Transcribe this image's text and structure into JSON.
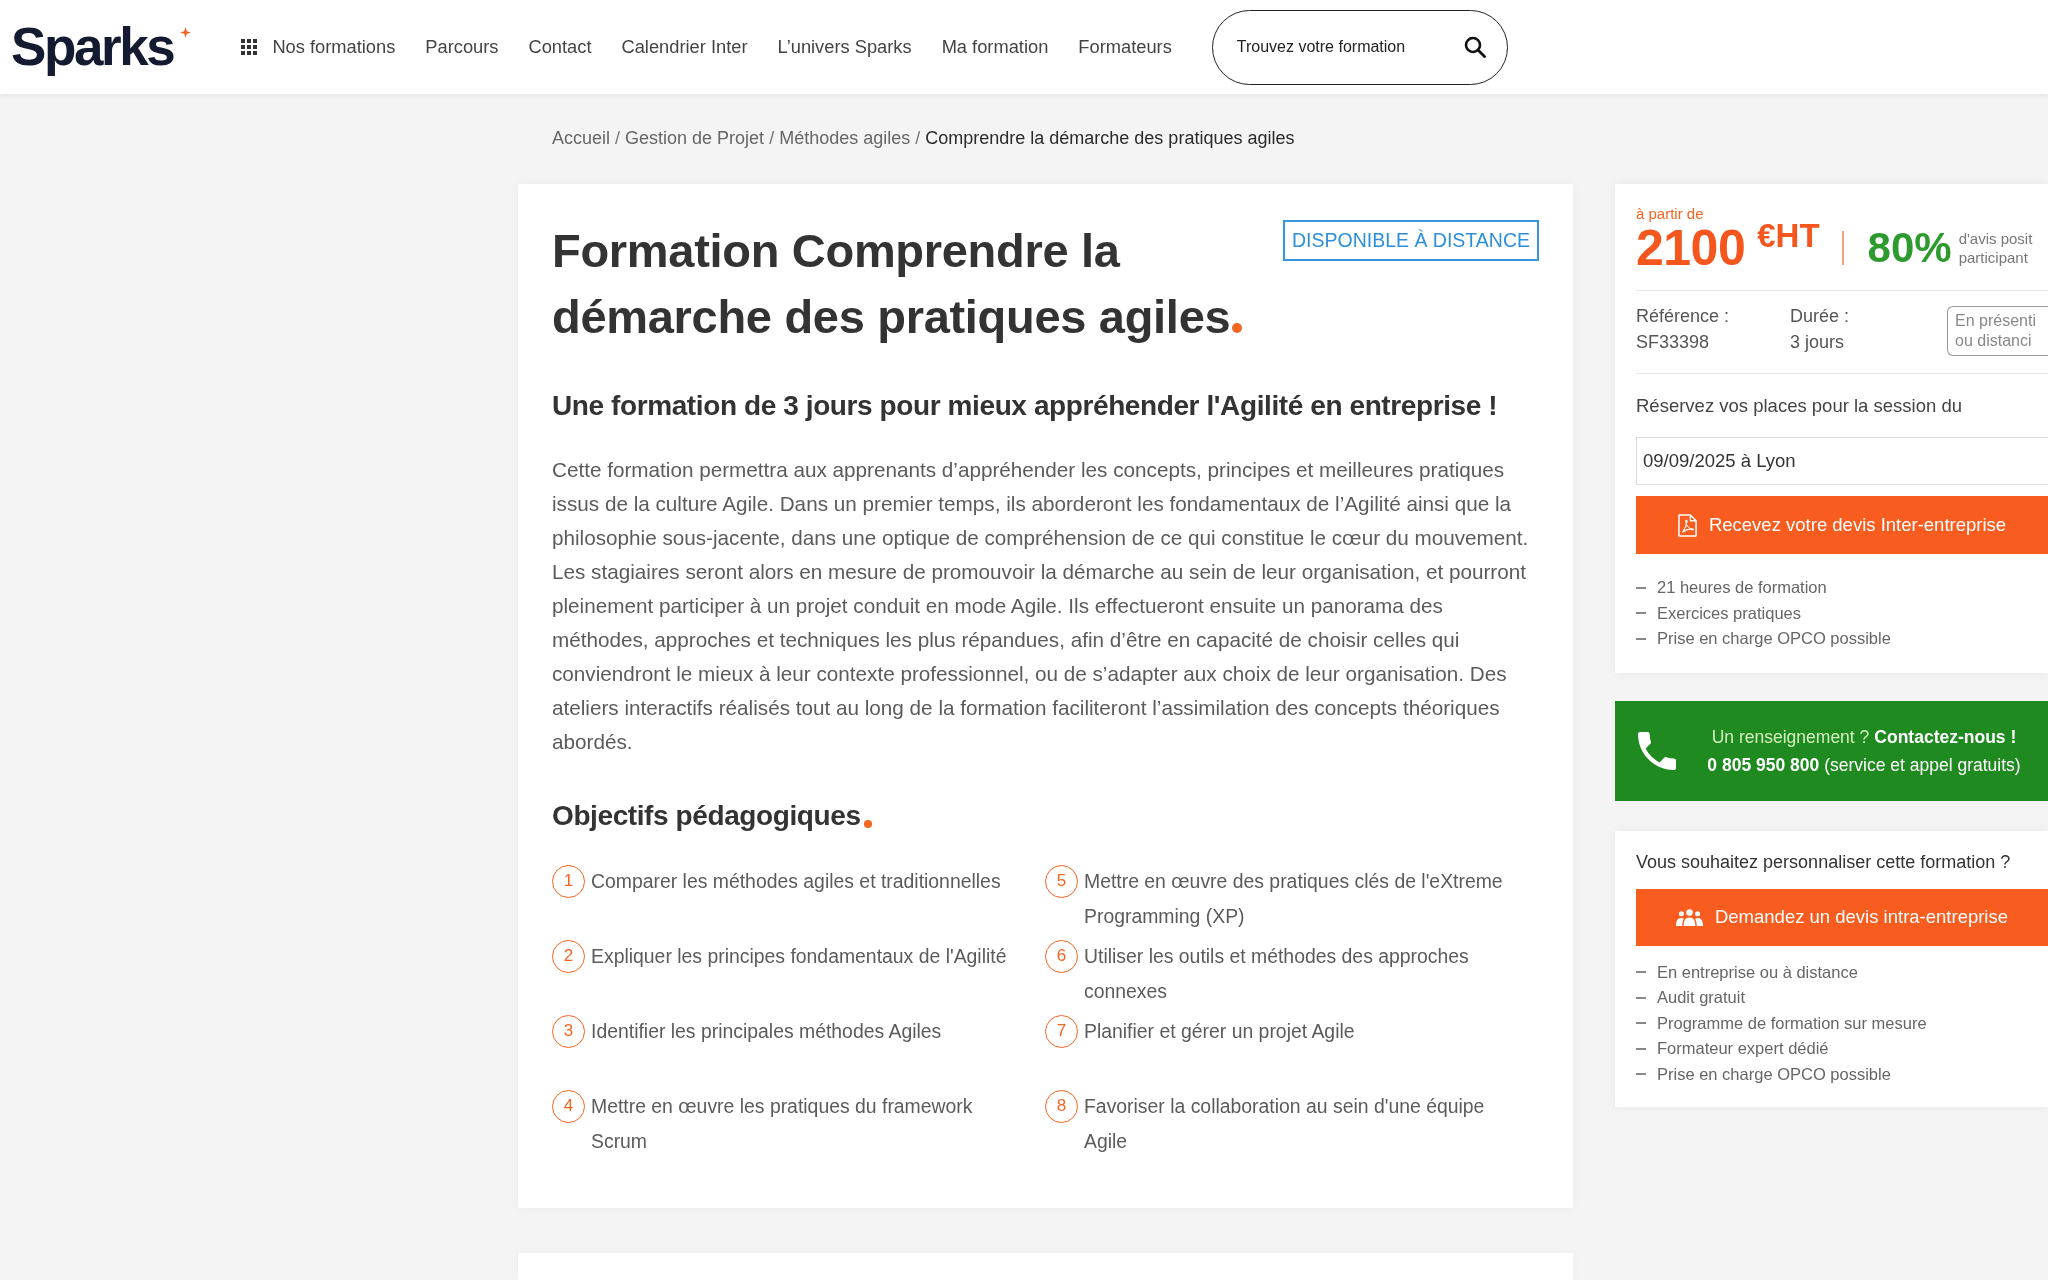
{
  "header": {
    "logo": "Sparks",
    "nav": [
      {
        "label": "Nos formations",
        "kind": "menu"
      },
      {
        "label": "Parcours",
        "kind": "link"
      },
      {
        "label": "Contact",
        "kind": "link"
      },
      {
        "label": "Calendrier Inter",
        "kind": "link"
      },
      {
        "label": "L’univers Sparks",
        "kind": "link"
      },
      {
        "label": "Ma formation",
        "kind": "link"
      },
      {
        "label": "Formateurs",
        "kind": "link"
      }
    ],
    "search": {
      "placeholder": "Trouvez votre formation"
    }
  },
  "breadcrumb": {
    "separator": "/",
    "items": [
      {
        "label": "Accueil",
        "current": false
      },
      {
        "label": "Gestion de Projet",
        "current": false
      },
      {
        "label": "Méthodes agiles",
        "current": false
      },
      {
        "label": "Comprendre la démarche des pratiques agiles",
        "current": true
      }
    ]
  },
  "course": {
    "badge": "DISPONIBLE À DISTANCE",
    "title": "Formation Comprendre la démarche des pratiques agiles",
    "subtitle": "Une formation de 3 jours pour mieux appréhender l'Agilité en entreprise !",
    "description": "Cette formation permettra aux apprenants d’appréhender les concepts, principes et meilleures pratiques issus de la culture Agile. Dans un premier temps, ils aborderont les fondamentaux de l’Agilité ainsi que la philosophie sous-jacente, dans une optique de compréhension de ce qui constitue le cœur du mouvement. Les stagiaires seront alors en mesure de promouvoir la démarche au sein de leur organisation, et pourront pleinement participer à un projet conduit en mode Agile. Ils effectueront ensuite un panorama des méthodes, approches et techniques les plus répandues, afin d’être en capacité de choisir celles qui conviendront le mieux à leur contexte professionnel, ou de s’adapter aux choix de leur organisation. Des ateliers interactifs réalisés tout au long de la formation faciliteront l’assimilation des concepts théoriques abordés.",
    "objectives_title": "Objectifs pédagogiques",
    "objectives": [
      {
        "number": "1",
        "text": "Comparer les méthodes agiles et traditionnelles"
      },
      {
        "number": "2",
        "text": "Expliquer les principes fondamentaux de l'Agilité"
      },
      {
        "number": "3",
        "text": "Identifier les principales méthodes Agiles"
      },
      {
        "number": "4",
        "text": "Mettre en œuvre les pratiques du framework Scrum"
      },
      {
        "number": "5",
        "text": "Mettre en œuvre des pratiques clés de l'eXtreme Programming (XP)"
      },
      {
        "number": "6",
        "text": "Utiliser les outils et méthodes des approches connexes"
      },
      {
        "number": "7",
        "text": "Planifier et gérer un projet Agile"
      },
      {
        "number": "8",
        "text": "Favoriser la collaboration au sein d'une équipe Agile"
      }
    ]
  },
  "pricing": {
    "from_label": "à partir de",
    "price": "2100",
    "currency": "€HT",
    "rating": "80%",
    "rating_caption": [
      "d'avis posit",
      "participant"
    ],
    "details": [
      {
        "label": "Référence :",
        "value": "SF33398"
      },
      {
        "label": "Durée :",
        "value": "3 jours"
      }
    ],
    "format": [
      "En présenti",
      "ou distanci"
    ],
    "session_label": "Réservez vos places pour la session du",
    "session": {
      "value": "09/09/2025 à Lyon"
    },
    "quote_button": "Recevez votre devis Inter-entreprise",
    "features": [
      "21 heures de formation",
      "Exercices pratiques",
      "Prise en charge OPCO possible"
    ]
  },
  "contact": {
    "question": "Un renseignement ?",
    "link": "Contactez-nous !",
    "phone": "**0 805 950 800** (service et appel gratuits)"
  },
  "customization": {
    "question": "Vous souhaitez personnaliser cette formation ?",
    "button": "Demandez un devis intra-entreprise",
    "features": [
      "En entreprise ou à distance",
      "Audit gratuit",
      "Programme de formation sur mesure",
      "Formateur expert dédié",
      "Prise en charge OPCO possible"
    ]
  }
}
